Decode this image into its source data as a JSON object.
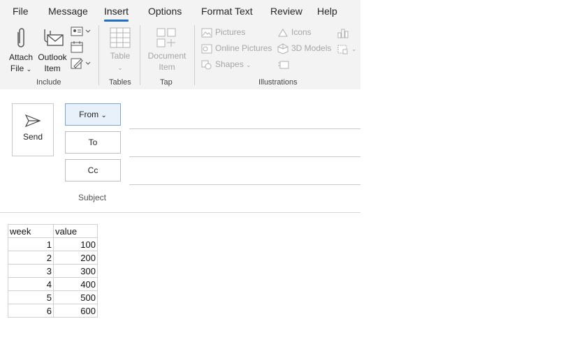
{
  "tabs": [
    {
      "label": "File",
      "active": false
    },
    {
      "label": "Message",
      "active": false
    },
    {
      "label": "Insert",
      "active": true
    },
    {
      "label": "Options",
      "active": false
    },
    {
      "label": "Format Text",
      "active": false
    },
    {
      "label": "Review",
      "active": false
    },
    {
      "label": "Help",
      "active": false
    }
  ],
  "ribbon": {
    "include": {
      "label": "Include",
      "attach_file": "Attach File",
      "attach_line1": "Attach",
      "attach_line2": "File",
      "outlook_line1": "Outlook",
      "outlook_line2": "Item"
    },
    "tables": {
      "label": "Tables",
      "table": "Table"
    },
    "tap": {
      "label": "Tap",
      "doc_line1": "Document",
      "doc_line2": "Item"
    },
    "illustrations": {
      "label": "Illustrations",
      "pictures": "Pictures",
      "online_pictures": "Online Pictures",
      "shapes": "Shapes",
      "icons": "Icons",
      "models_3d": "3D Models"
    }
  },
  "compose": {
    "send": "Send",
    "from": "From",
    "to": "To",
    "cc": "Cc",
    "subject": "Subject"
  },
  "table": {
    "headers": [
      "week",
      "value"
    ],
    "rows": [
      [
        "1",
        "100"
      ],
      [
        "2",
        "200"
      ],
      [
        "3",
        "300"
      ],
      [
        "4",
        "400"
      ],
      [
        "5",
        "500"
      ],
      [
        "6",
        "600"
      ]
    ]
  },
  "colors": {
    "accent": "#1f6fc4",
    "ribbon_bg": "#f3f3f3",
    "disabled_text": "#a6a6a6"
  }
}
